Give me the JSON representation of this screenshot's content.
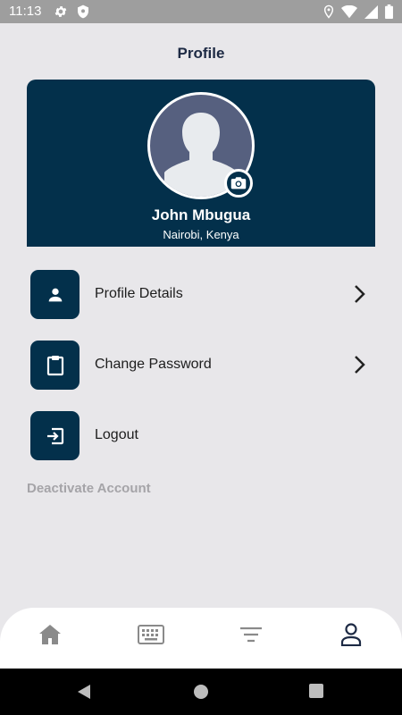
{
  "status_bar": {
    "time": "11:13",
    "icons_left": [
      "gear-icon",
      "shield-icon"
    ],
    "icons_right": [
      "location-icon",
      "wifi-icon",
      "signal-icon",
      "battery-icon"
    ]
  },
  "header": {
    "title": "Profile"
  },
  "profile": {
    "name": "John Mbugua",
    "location": "Nairobi, Kenya",
    "avatar_icon": "person-silhouette-icon",
    "camera_icon": "camera-icon"
  },
  "menu": {
    "items": [
      {
        "label": "Profile Details",
        "icon": "person-icon",
        "has_chevron": true
      },
      {
        "label": "Change Password",
        "icon": "clipboard-icon",
        "has_chevron": true
      },
      {
        "label": "Logout",
        "icon": "logout-icon",
        "has_chevron": false
      }
    ]
  },
  "deactivate_label": "Deactivate Account",
  "bottom_nav": {
    "items": [
      {
        "icon": "home-icon",
        "active": false
      },
      {
        "icon": "keyboard-icon",
        "active": false
      },
      {
        "icon": "filter-icon",
        "active": false
      },
      {
        "icon": "profile-icon",
        "active": true
      }
    ]
  },
  "colors": {
    "primary": "#03304b",
    "background": "#e8e7ea",
    "avatar_bg": "#56607f",
    "muted_text": "#a5a4a8",
    "nav_inactive": "#8a8a8a",
    "nav_active": "#1d2a44"
  }
}
